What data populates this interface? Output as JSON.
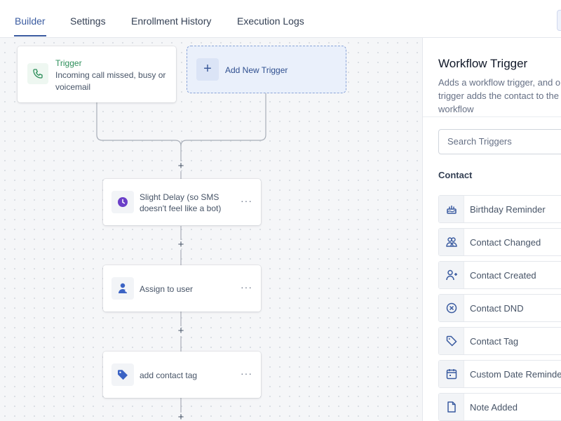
{
  "tabs": [
    {
      "label": "Builder",
      "active": true
    },
    {
      "label": "Settings",
      "active": false
    },
    {
      "label": "Enrollment History",
      "active": false
    },
    {
      "label": "Execution Logs",
      "active": false
    }
  ],
  "canvas": {
    "trigger": {
      "title": "Trigger",
      "description": "Incoming call missed, busy or voicemail",
      "icon": "phone-icon"
    },
    "add_trigger": {
      "plus": "+",
      "label": "Add New Trigger"
    },
    "plus_symbol": "+",
    "menu_dots": "···",
    "actions": [
      {
        "label": "Slight Delay (so SMS doesn't feel like a bot)",
        "icon": "clock-icon"
      },
      {
        "label": "Assign to user",
        "icon": "assign-user-icon"
      },
      {
        "label": "add contact tag",
        "icon": "tag-icon"
      }
    ]
  },
  "panel": {
    "title": "Workflow Trigger",
    "description": "Adds a workflow trigger, and on trigger adds the contact to the workflow",
    "search_placeholder": "Search Triggers",
    "section": "Contact",
    "items": [
      {
        "label": "Birthday Reminder",
        "icon": "cake-icon"
      },
      {
        "label": "Contact Changed",
        "icon": "contacts-icon"
      },
      {
        "label": "Contact Created",
        "icon": "user-plus-icon"
      },
      {
        "label": "Contact DND",
        "icon": "dnd-icon"
      },
      {
        "label": "Contact Tag",
        "icon": "tag-outline-icon"
      },
      {
        "label": "Custom Date Reminder",
        "icon": "calendar-icon"
      },
      {
        "label": "Note Added",
        "icon": "note-icon"
      }
    ]
  },
  "colors": {
    "accent": "#3a5ba0",
    "trigger_green": "#2e8f5b",
    "purple": "#6b3fc8",
    "blue_action": "#3b63c4"
  }
}
